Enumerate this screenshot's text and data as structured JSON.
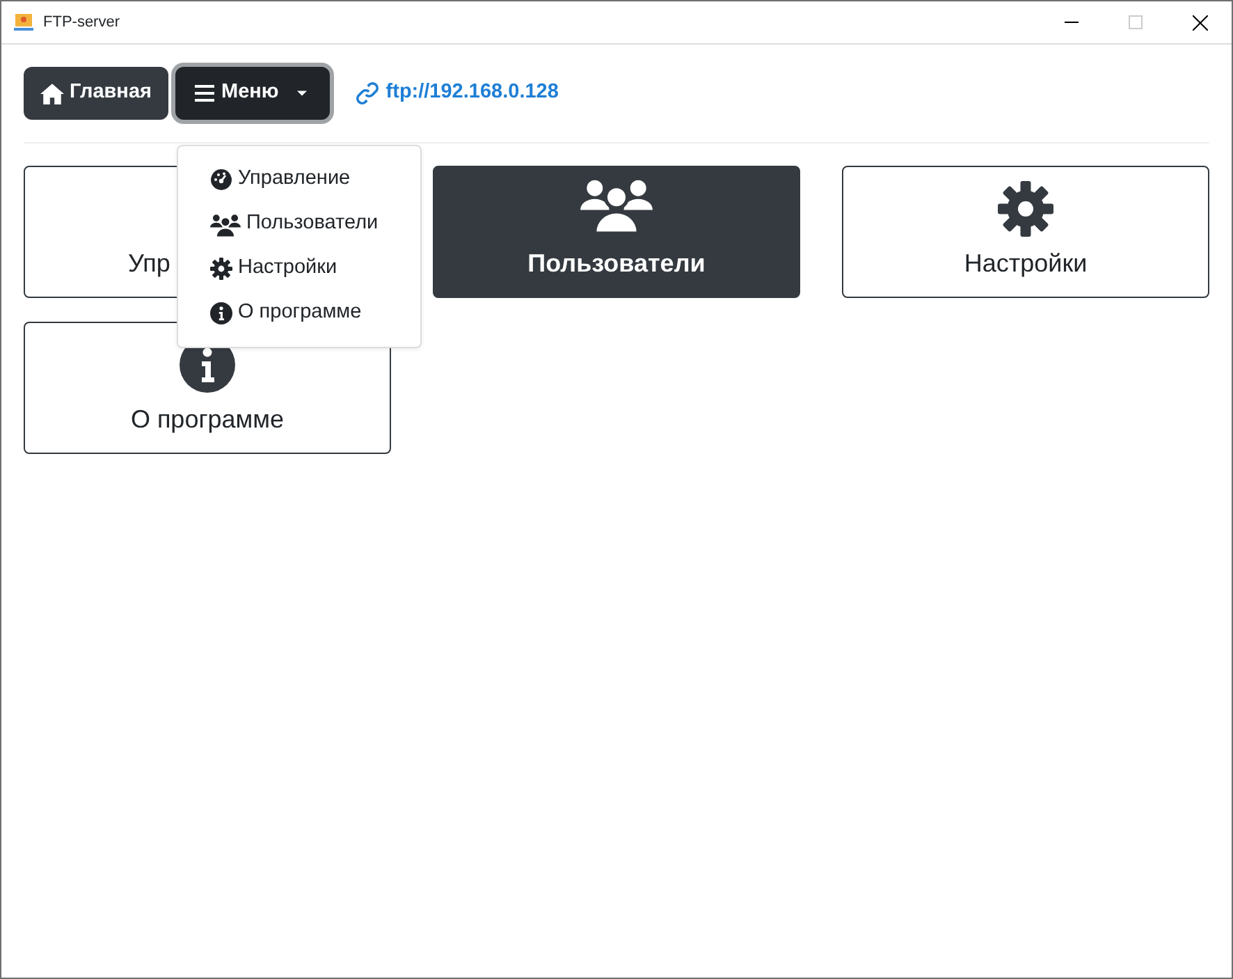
{
  "window": {
    "title": "FTP-server"
  },
  "nav": {
    "home": "Главная",
    "menu": "Меню",
    "menu_open": true,
    "link": "ftp://192.168.0.128"
  },
  "menu_items": [
    {
      "label": "Управление"
    },
    {
      "label": "Пользователи"
    },
    {
      "label": "Настройки"
    },
    {
      "label": "О программе"
    }
  ],
  "tiles": [
    {
      "label": "Упр",
      "kind": "covered",
      "selected": false
    },
    {
      "label": "Пользователи",
      "kind": "full",
      "selected": true
    },
    {
      "label": "Настройки",
      "kind": "full",
      "selected": false
    },
    {
      "label": "О программе",
      "kind": "full",
      "selected": false
    }
  ]
}
